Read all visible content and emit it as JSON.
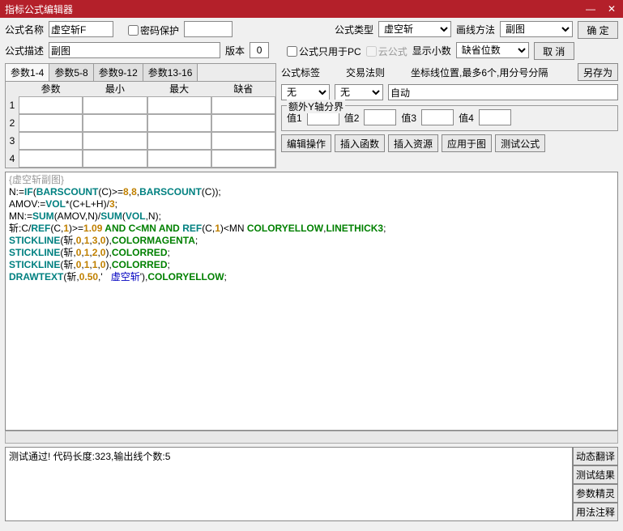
{
  "window": {
    "title": "指标公式编辑器"
  },
  "labels": {
    "name": "公式名称",
    "pwd": "密码保护",
    "type": "公式类型",
    "drawmethod": "画线方法",
    "desc": "公式描述",
    "version": "版本",
    "pconly": "公式只用于PC",
    "cloud": "云公式",
    "decimals": "显示小数",
    "tag": "公式标签",
    "rule": "交易法则",
    "coord": "坐标线位置,最多6个,用分号分隔",
    "extray": "额外Y轴分界",
    "v1": "值1",
    "v2": "值2",
    "v3": "值3",
    "v4": "值4"
  },
  "values": {
    "name": "虚空斩F",
    "type": "虚空斩",
    "drawmethod": "副图",
    "desc": "副图",
    "version": "0",
    "decimals": "缺省位数",
    "tag": "无",
    "rule": "无",
    "coord": "自动"
  },
  "buttons": {
    "ok": "确 定",
    "cancel": "取 消",
    "saveas": "另存为",
    "editop": "编辑操作",
    "insfn": "插入函数",
    "insres": "插入资源",
    "applychart": "应用于图",
    "test": "测试公式",
    "dyntrans": "动态翻译",
    "testres": "测试结果",
    "paramwiz": "参数精灵",
    "usage": "用法注释"
  },
  "paramtabs": [
    "参数1-4",
    "参数5-8",
    "参数9-12",
    "参数13-16"
  ],
  "paramhdr": [
    "参数",
    "最小",
    "最大",
    "缺省"
  ],
  "code": {
    "title": "{虚空斩副图}",
    "l1a": "N:=",
    "l1b": "IF",
    "l1c": "(",
    "l1d": "BARSCOUNT",
    "l1e": "(C)>=",
    "l1f": "8",
    "l1g": ",",
    "l1h": "8",
    "l1i": ",",
    "l1j": "BARSCOUNT",
    "l1k": "(C));",
    "l2a": "AMOV:=",
    "l2b": "VOL",
    "l2c": "*(C+L+H)/",
    "l2d": "3",
    "l2e": ";",
    "l3a": "MN:=",
    "l3b": "SUM",
    "l3c": "(AMOV,N)/",
    "l3d": "SUM",
    "l3e": "(",
    "l3f": "VOL",
    "l3g": ",N);",
    "l4a": "斩:C/",
    "l4b": "REF",
    "l4c": "(C,",
    "l4d": "1",
    "l4e": ")>=",
    "l4f": "1.09",
    "l4g": " AND C<MN AND ",
    "l4h": "REF",
    "l4i": "(C,",
    "l4j": "1",
    "l4k": ")<MN ",
    "l4l": "COLORYELLOW",
    "l4m": ",",
    "l4n": "LINETHICK3",
    "l4o": ";",
    "l5a": "STICKLINE",
    "l5b": "(斩,",
    "l5c": "0",
    "l5d": ",",
    "l5e": "1",
    "l5f": ",",
    "l5g": "3",
    "l5h": ",",
    "l5i": "0",
    "l5j": "),",
    "l5k": "COLORMAGENTA",
    "l5l": ";",
    "l6a": "STICKLINE",
    "l6b": "(斩,",
    "l6c": "0",
    "l6d": ",",
    "l6e": "1",
    "l6f": ",",
    "l6g": "2",
    "l6h": ",",
    "l6i": "0",
    "l6j": "),",
    "l6k": "COLORRED",
    "l6l": ";",
    "l7a": "STICKLINE",
    "l7b": "(斩,",
    "l7c": "0",
    "l7d": ",",
    "l7e": "1",
    "l7f": ",",
    "l7g": "1",
    "l7h": ",",
    "l7i": "0",
    "l7j": "),",
    "l7k": "COLORRED",
    "l7l": ";",
    "l8a": "DRAWTEXT",
    "l8b": "(斩,",
    "l8c": "0.50",
    "l8d": ",'   ",
    "l8e": "虚空斩",
    "l8f": "'),",
    "l8g": "COLORYELLOW",
    "l8h": ";"
  },
  "status": "测试通过! 代码长度:323,输出线个数:5"
}
